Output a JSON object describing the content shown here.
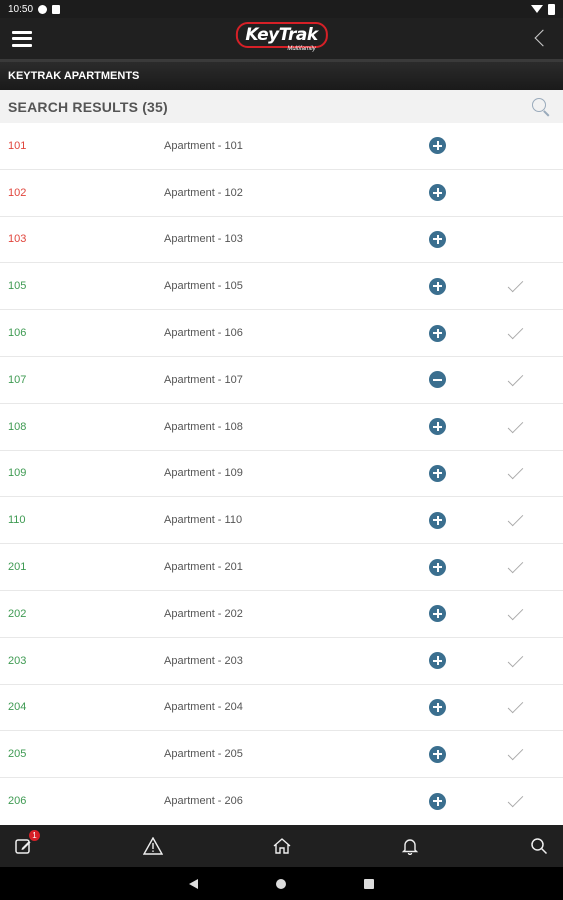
{
  "status_bar": {
    "time": "10:50"
  },
  "app_bar": {
    "logo_text": "KeyTrak",
    "logo_sub": "Multifamily"
  },
  "section": {
    "title": "KEYTRAK APARTMENTS"
  },
  "search": {
    "title": "SEARCH RESULTS (35)"
  },
  "colors": {
    "red": "#e0453c",
    "green": "#3e9a52",
    "accent": "#3b6f8f",
    "brand": "#d62027"
  },
  "rows": [
    {
      "num": "101",
      "name": "Apartment - 101",
      "status": "red",
      "action": "add",
      "checked": false
    },
    {
      "num": "102",
      "name": "Apartment - 102",
      "status": "red",
      "action": "add",
      "checked": false
    },
    {
      "num": "103",
      "name": "Apartment - 103",
      "status": "red",
      "action": "add",
      "checked": false
    },
    {
      "num": "105",
      "name": "Apartment - 105",
      "status": "green",
      "action": "add",
      "checked": true
    },
    {
      "num": "106",
      "name": "Apartment - 106",
      "status": "green",
      "action": "add",
      "checked": true
    },
    {
      "num": "107",
      "name": "Apartment - 107",
      "status": "green",
      "action": "remove",
      "checked": true
    },
    {
      "num": "108",
      "name": "Apartment - 108",
      "status": "green",
      "action": "add",
      "checked": true
    },
    {
      "num": "109",
      "name": "Apartment - 109",
      "status": "green",
      "action": "add",
      "checked": true
    },
    {
      "num": "110",
      "name": "Apartment - 110",
      "status": "green",
      "action": "add",
      "checked": true
    },
    {
      "num": "201",
      "name": "Apartment - 201",
      "status": "green",
      "action": "add",
      "checked": true
    },
    {
      "num": "202",
      "name": "Apartment - 202",
      "status": "green",
      "action": "add",
      "checked": true
    },
    {
      "num": "203",
      "name": "Apartment - 203",
      "status": "green",
      "action": "add",
      "checked": true
    },
    {
      "num": "204",
      "name": "Apartment - 204",
      "status": "green",
      "action": "add",
      "checked": true
    },
    {
      "num": "205",
      "name": "Apartment - 205",
      "status": "green",
      "action": "add",
      "checked": true
    },
    {
      "num": "206",
      "name": "Apartment - 206",
      "status": "green",
      "action": "add",
      "checked": true
    }
  ],
  "tab_bar": {
    "tabs": [
      {
        "icon": "edit-icon",
        "badge": "1"
      },
      {
        "icon": "warning-icon"
      },
      {
        "icon": "home-icon"
      },
      {
        "icon": "bell-icon"
      },
      {
        "icon": "search-icon"
      }
    ]
  }
}
